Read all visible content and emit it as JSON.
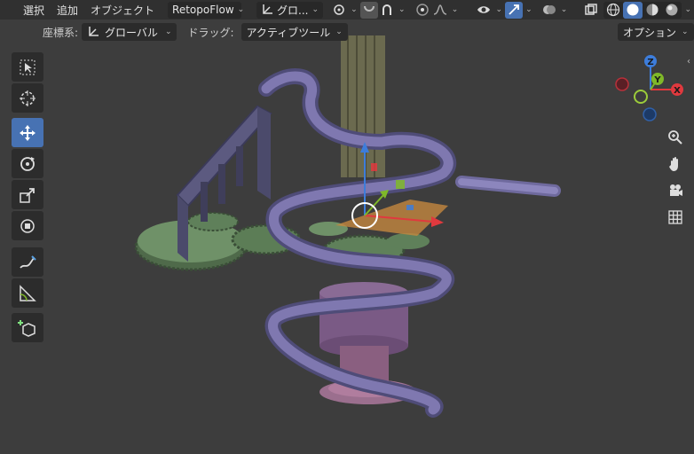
{
  "header": {
    "menu_select": "選択",
    "menu_add": "追加",
    "menu_object": "オブジェクト",
    "addon_dropdown": "RetopoFlow",
    "orientation_dropdown": "グロ..."
  },
  "subheader": {
    "coord_label": "座標系:",
    "coord_value": "グローバル",
    "drag_label": "ドラッグ:",
    "drag_value": "アクティブツール",
    "options_label": "オプション"
  },
  "gizmo": {
    "x_label": "X",
    "y_label": "Y",
    "z_label": "Z"
  },
  "icons": [
    "select-box-icon",
    "cursor-icon",
    "move-icon",
    "rotate-icon",
    "scale-icon",
    "transform-icon",
    "annotate-icon",
    "measure-icon",
    "add-cube-icon",
    "zoom-icon",
    "hand-icon",
    "camera-icon",
    "grid-icon"
  ],
  "colors": {
    "header_bg": "#303030",
    "viewport_bg": "#3d3d3d",
    "active_blue": "#4772b3",
    "axis_x": "#e0393e",
    "axis_y": "#7fb829",
    "axis_z": "#3d7ddb"
  }
}
